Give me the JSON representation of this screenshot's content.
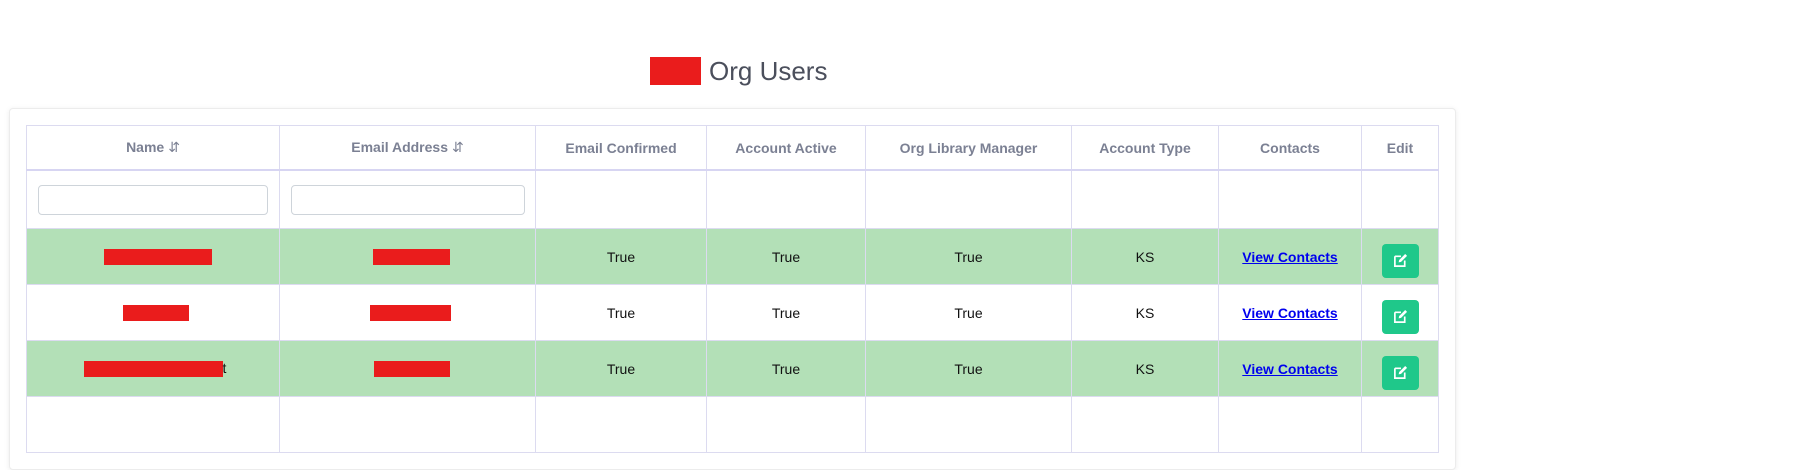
{
  "page": {
    "title": "Org Users"
  },
  "table": {
    "headers": {
      "name": "Name",
      "email": "Email Address",
      "email_confirmed": "Email Confirmed",
      "account_active": "Account Active",
      "org_library_manager": "Org Library Manager",
      "account_type": "Account Type",
      "contacts": "Contacts",
      "edit": "Edit",
      "sort_glyph": "⇵"
    },
    "rows": [
      {
        "name_suffix": "",
        "email_confirmed": "True",
        "account_active": "True",
        "org_library_manager": "True",
        "account_type": "KS",
        "contacts_link": "View Contacts"
      },
      {
        "name_suffix": "",
        "email_confirmed": "True",
        "account_active": "True",
        "org_library_manager": "True",
        "account_type": "KS",
        "contacts_link": "View Contacts"
      },
      {
        "name_suffix": "t",
        "email_confirmed": "True",
        "account_active": "True",
        "org_library_manager": "True",
        "account_type": "KS",
        "contacts_link": "View Contacts"
      }
    ]
  },
  "colors": {
    "accent_green": "#1fc88a",
    "row_highlight": "#b3e0b7",
    "redaction": "#ea1c1c"
  },
  "icons": {
    "edit": "edit-icon",
    "sort": "sort-icon"
  }
}
